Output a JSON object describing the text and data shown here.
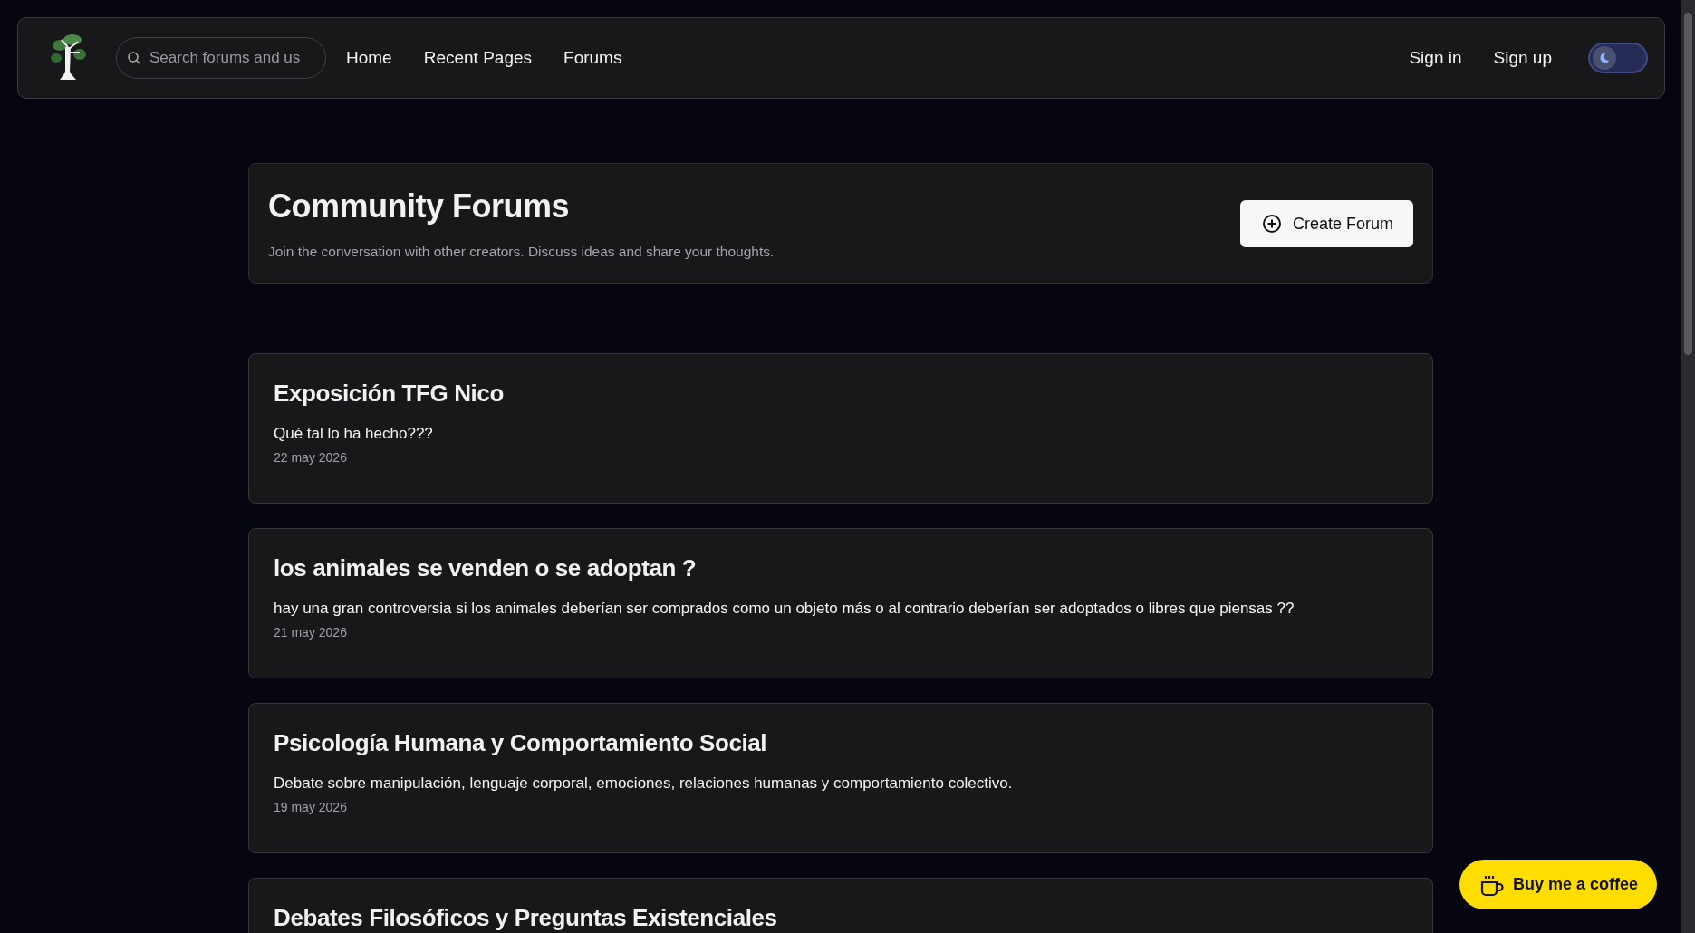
{
  "nav": {
    "search": {
      "placeholder": "Search forums and us"
    },
    "links": [
      {
        "label": "Home"
      },
      {
        "label": "Recent Pages"
      },
      {
        "label": "Forums"
      }
    ],
    "auth": [
      {
        "label": "Sign in"
      },
      {
        "label": "Sign up"
      }
    ],
    "light_mode_toggle": {
      "on": false
    }
  },
  "page_header": {
    "title": "Community Forums",
    "subtitle": "Join the conversation with other creators. Discuss ideas and share your thoughts.",
    "button": "Create Forum"
  },
  "forums": [
    {
      "title": "Exposición TFG Nico",
      "description": "Qué tal lo ha hecho???",
      "date": "22 may 2026"
    },
    {
      "title": "los animales se venden o se adoptan ?",
      "description": "hay una gran controversia si los animales deberían ser comprados como un objeto más o al contrario deberían ser adoptados o libres que piensas ??",
      "date": "21 may 2026"
    },
    {
      "title": "Psicología Humana y Comportamiento Social",
      "description": "Debate sobre manipulación, lenguaje corporal, emociones, relaciones humanas y comportamiento colectivo.",
      "date": "19 may 2026"
    },
    {
      "title": "Debates Filosóficos y Preguntas Existenciales"
    }
  ],
  "coffee_button": "Buy me a coffee"
}
